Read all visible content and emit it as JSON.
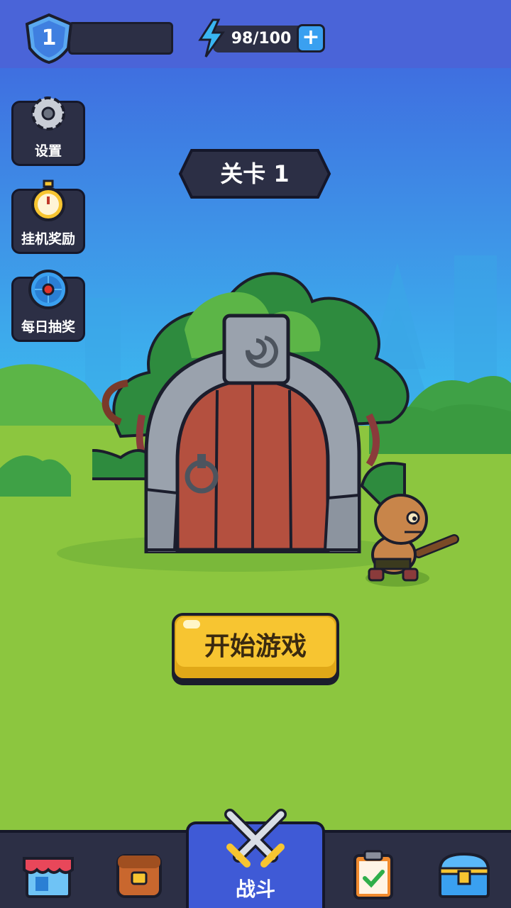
{
  "player": {
    "level": "1"
  },
  "energy": {
    "text": "98/100",
    "plus": "+"
  },
  "side_buttons": [
    {
      "label": "设置",
      "icon": "gear-icon"
    },
    {
      "label": "挂机奖励",
      "icon": "stopwatch-icon"
    },
    {
      "label": "每日抽奖",
      "icon": "wheel-icon"
    }
  ],
  "stage": {
    "title": "关卡 1"
  },
  "start_button": {
    "label": "开始游戏"
  },
  "bottom_nav": {
    "shop_icon": "shop-icon",
    "bag_icon": "backpack-icon",
    "battle_label": "战斗",
    "battle_icon": "crossed-swords-icon",
    "tasks_icon": "clipboard-icon",
    "chest_icon": "treasure-chest-icon"
  },
  "colors": {
    "topbar": "#4a64d8",
    "sky_top": "#3f6fe0",
    "grass": "#8cc63f",
    "button_yellow": "#f7c531",
    "nav": "#2c2f45"
  }
}
